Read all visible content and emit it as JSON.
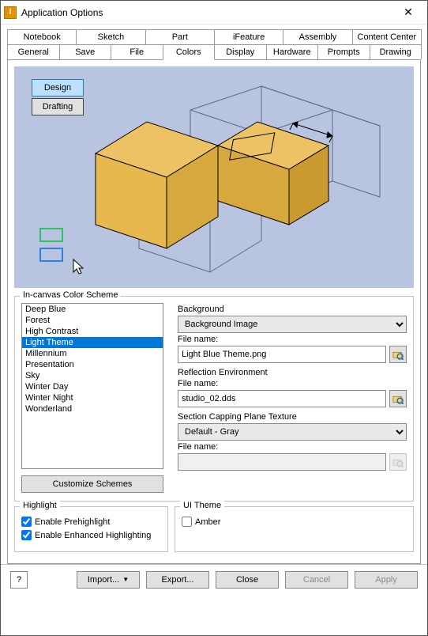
{
  "window": {
    "title": "Application Options"
  },
  "tabs_row1": [
    "Notebook",
    "Sketch",
    "Part",
    "iFeature",
    "Assembly",
    "Content Center"
  ],
  "tabs_row2": [
    "General",
    "Save",
    "File",
    "Colors",
    "Display",
    "Hardware",
    "Prompts",
    "Drawing"
  ],
  "active_tab": "Colors",
  "preview": {
    "design_label": "Design",
    "drafting_label": "Drafting"
  },
  "group_scheme": {
    "title": "In-canvas Color Scheme",
    "items": [
      "Deep Blue",
      "Forest",
      "High Contrast",
      "Light Theme",
      "Millennium",
      "Presentation",
      "Sky",
      "Winter Day",
      "Winter Night",
      "Wonderland"
    ],
    "selected": "Light Theme",
    "customize_label": "Customize Schemes"
  },
  "right": {
    "background_label": "Background",
    "background_value": "Background Image",
    "filename_label": "File name:",
    "bg_file": "Light Blue Theme.png",
    "reflection_label": "Reflection Environment",
    "reflection_file": "studio_02.dds",
    "section_label": "Section Capping Plane Texture",
    "section_value": "Default - Gray",
    "section_file": ""
  },
  "highlight": {
    "title": "Highlight",
    "pre": "Enable Prehighlight",
    "enh": "Enable Enhanced Highlighting"
  },
  "uitheme": {
    "title": "UI Theme",
    "amber": "Amber"
  },
  "footer": {
    "help": "?",
    "import": "Import...",
    "export": "Export...",
    "close": "Close",
    "cancel": "Cancel",
    "apply": "Apply"
  }
}
